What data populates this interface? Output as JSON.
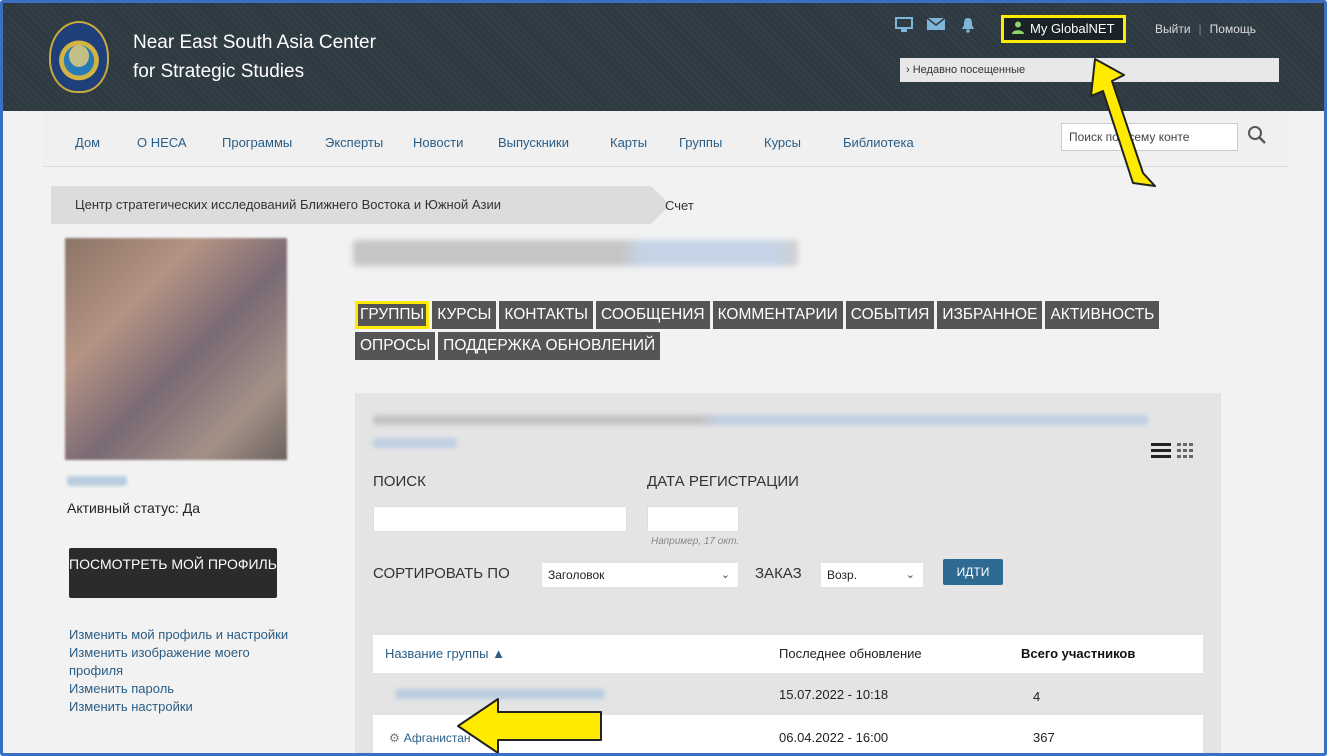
{
  "header": {
    "org_line1": "Near East South Asia Center",
    "org_line2": "for Strategic Studies",
    "my_globalnet": "My GlobalNET",
    "logout": "Выйти",
    "help": "Помощь",
    "recently_visited": "Недавно посещенные"
  },
  "nav": {
    "items": [
      "Дом",
      "О НЕСА",
      "Программы",
      "Эксперты",
      "Новости",
      "Выпускники",
      "Карты",
      "Группы",
      "Курсы",
      "Библиотека"
    ],
    "search_placeholder": "Поиск по всему конте"
  },
  "breadcrumb": {
    "parent": "Центр стратегических исследований Ближнего Востока и Южной Азии",
    "current": "Счет"
  },
  "sidebar": {
    "active_status": "Активный статус: Да",
    "view_profile": "ПОСМОТРЕТЬ МОЙ ПРОФИЛЬ",
    "links": [
      "Изменить мой профиль и настройки",
      "Изменить изображение моего профиля",
      "Изменить пароль",
      "Изменить настройки"
    ]
  },
  "tabs": [
    "ГРУППЫ",
    "КУРСЫ",
    "КОНТАКТЫ",
    "СООБЩЕНИЯ",
    "КОММЕНТАРИИ",
    "СОБЫТИЯ",
    "ИЗБРАННОЕ",
    "АКТИВНОСТЬ",
    "ОПРОСЫ",
    "ПОДДЕРЖКА ОБНОВЛЕНИЙ"
  ],
  "filters": {
    "search_label": "ПОИСК",
    "date_label": "ДАТА РЕГИСТРАЦИИ",
    "date_hint": "Например, 17 окт.",
    "sort_label": "СОРТИРОВАТЬ ПО",
    "sort_value": "Заголовок",
    "order_label": "ЗАКАЗ",
    "order_value": "Возр.",
    "go": "ИДТИ"
  },
  "table": {
    "headers": [
      "Название группы ▲",
      "Последнее обновление",
      "Всего участников"
    ],
    "rows": [
      {
        "name": "",
        "updated": "15.07.2022 - 10:18",
        "members": "4"
      },
      {
        "name": "Афганистан",
        "updated": "06.04.2022 - 16:00",
        "members": "367"
      }
    ]
  },
  "colors": {
    "header_bg": "#2e3a42",
    "highlight": "#ffeb00",
    "link": "#2a5d85",
    "tab_bg": "#555555",
    "go_button": "#2e6a92"
  }
}
